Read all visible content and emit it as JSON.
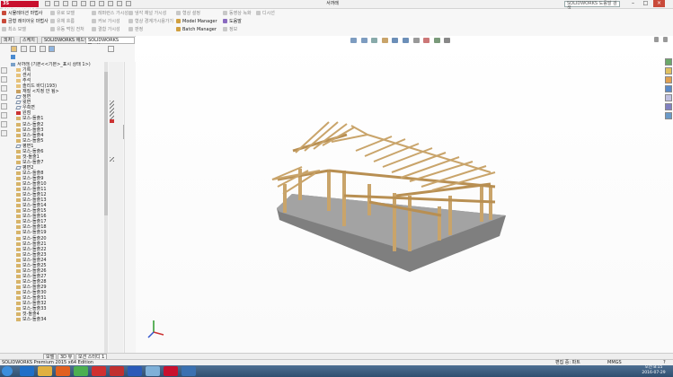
{
  "app": {
    "logo_text": "3S SOLIDWORKS",
    "document_title": "서까래",
    "search_placeholder": "SOLIDWORKS 도움말 검색",
    "window_buttons": [
      "–",
      "□",
      "×"
    ]
  },
  "ribbon": {
    "groups": [
      {
        "items": [
          {
            "label": "시뮬레이션 마법사",
            "icon": "wizard-icon",
            "enabled": true
          },
          {
            "label": "금형 레이아웃 마법사",
            "icon": "mold-wizard-icon",
            "enabled": true
          },
          {
            "label": "최소 모델",
            "icon": "minimum-model-icon",
            "enabled": false
          }
        ]
      },
      {
        "items": [
          {
            "label": "유로 모델",
            "icon": "runner-model-icon",
            "enabled": false
          },
          {
            "label": "유체 흐름",
            "icon": "flow-icon",
            "enabled": false
          },
          {
            "label": "유동 먹임 전처",
            "icon": "feed-icon",
            "enabled": false
          }
        ]
      },
      {
        "items": [
          {
            "label": "레퍼런스 가시성",
            "icon": "reference-visibility-icon",
            "enabled": false
          },
          {
            "label": "커브 가시성",
            "icon": "curve-visibility-icon",
            "enabled": false
          },
          {
            "label": "결합 가시성",
            "icon": "mate-visibility-icon",
            "enabled": false
          }
        ]
      },
      {
        "items": [
          {
            "label": "냉각 채널 가시성",
            "icon": "cooling-channel-icon",
            "enabled": false
          },
          {
            "label": "형상 경계가시용가기",
            "icon": "geometry-boundary-icon",
            "enabled": false
          },
          {
            "label": "판정",
            "icon": "judgement-icon",
            "enabled": false
          }
        ]
      },
      {
        "items": [
          {
            "label": "형상 설정",
            "icon": "shape-settings-icon",
            "enabled": false
          },
          {
            "label": "Model Manager",
            "icon": "model-manager-icon",
            "enabled": true
          },
          {
            "label": "Batch Manager",
            "icon": "batch-manager-icon",
            "enabled": true
          }
        ]
      },
      {
        "items": [
          {
            "label": "동영상 녹화",
            "icon": "record-icon",
            "enabled": false
          },
          {
            "label": "도움말",
            "icon": "help-icon",
            "enabled": true
          },
          {
            "label": "정보",
            "icon": "info-icon",
            "enabled": false
          }
        ]
      },
      {
        "items": [
          {
            "label": "디시선",
            "icon": "lines-icon",
            "enabled": false
          }
        ]
      }
    ]
  },
  "cm_tabs": [
    "피처",
    "스케치",
    "SOLIDWORKS 애드인",
    "SOLIDWORKS Plastics"
  ],
  "cm_active_tab": 3,
  "tree": {
    "root": "서까래 (기본<<기본>_표시 상태 1>)",
    "items": [
      {
        "label": "기록",
        "icon": "folder"
      },
      {
        "label": "센서",
        "icon": "folder"
      },
      {
        "label": "주석",
        "icon": "folder"
      },
      {
        "label": "솔리드 바디(193)",
        "icon": "folder"
      },
      {
        "label": "재질 <지정 안 됨>",
        "icon": "material"
      },
      {
        "label": "정면",
        "icon": "plane"
      },
      {
        "label": "윗면",
        "icon": "plane"
      },
      {
        "label": "우측면",
        "icon": "plane"
      },
      {
        "label": "원점",
        "icon": "origin"
      },
      {
        "label": "보스-돌출1",
        "icon": "feature"
      },
      {
        "label": "보스-돌출2",
        "icon": "feature"
      },
      {
        "label": "보스-돌출3",
        "icon": "feature"
      },
      {
        "label": "보스-돌출4",
        "icon": "feature"
      },
      {
        "label": "보스-돌출5",
        "icon": "feature"
      },
      {
        "label": "평면1",
        "icon": "plane"
      },
      {
        "label": "보스-돌출6",
        "icon": "feature"
      },
      {
        "label": "컷-돌출1",
        "icon": "feature"
      },
      {
        "label": "보스-돌출7",
        "icon": "feature"
      },
      {
        "label": "평면2",
        "icon": "plane"
      },
      {
        "label": "보스-돌출8",
        "icon": "feature"
      },
      {
        "label": "보스-돌출9",
        "icon": "feature"
      },
      {
        "label": "보스-돌출10",
        "icon": "feature"
      },
      {
        "label": "보스-돌출11",
        "icon": "feature"
      },
      {
        "label": "보스-돌출12",
        "icon": "feature"
      },
      {
        "label": "보스-돌출13",
        "icon": "feature"
      },
      {
        "label": "보스-돌출14",
        "icon": "feature"
      },
      {
        "label": "보스-돌출15",
        "icon": "feature"
      },
      {
        "label": "보스-돌출16",
        "icon": "feature"
      },
      {
        "label": "보스-돌출17",
        "icon": "feature"
      },
      {
        "label": "보스-돌출18",
        "icon": "feature"
      },
      {
        "label": "보스-돌출19",
        "icon": "feature"
      },
      {
        "label": "보스-돌출20",
        "icon": "feature"
      },
      {
        "label": "보스-돌출21",
        "icon": "feature"
      },
      {
        "label": "보스-돌출22",
        "icon": "feature"
      },
      {
        "label": "보스-돌출23",
        "icon": "feature"
      },
      {
        "label": "보스-돌출24",
        "icon": "feature"
      },
      {
        "label": "보스-돌출25",
        "icon": "feature"
      },
      {
        "label": "보스-돌출26",
        "icon": "feature"
      },
      {
        "label": "보스-돌출27",
        "icon": "feature"
      },
      {
        "label": "보스-돌출28",
        "icon": "feature"
      },
      {
        "label": "보스-돌출29",
        "icon": "feature"
      },
      {
        "label": "보스-돌출30",
        "icon": "feature"
      },
      {
        "label": "보스-돌출31",
        "icon": "feature"
      },
      {
        "label": "보스-돌출32",
        "icon": "feature"
      },
      {
        "label": "보스-돌출33",
        "icon": "feature"
      },
      {
        "label": "컷-돌출4",
        "icon": "feature"
      },
      {
        "label": "보스-돌출34",
        "icon": "feature"
      }
    ]
  },
  "bottom_tabs": [
    "모델",
    "3D 뷰",
    "모션 스터디 1"
  ],
  "status": {
    "product": "SOLIDWORKS Premium 2015 x64 Edition",
    "editing": "편집 중: 파트",
    "units": "MMGS",
    "help_icon": "?"
  },
  "taskbar": {
    "apps": [
      "start-orb",
      "ie-icon",
      "explorer-icon",
      "media-icon",
      "chrome-icon",
      "acrobat-icon",
      "autocad-icon",
      "word-icon",
      "paint-icon",
      "solidworks-icon",
      "plastics-icon"
    ],
    "time": "오전 8:15",
    "date": "2016-07-29"
  },
  "colors": {
    "sw_red": "#c8102e",
    "wood": "#c9a46a",
    "wood_dark": "#8a6b3a",
    "base": "#8d8d8d",
    "taskbar": "#3a5a7c"
  }
}
